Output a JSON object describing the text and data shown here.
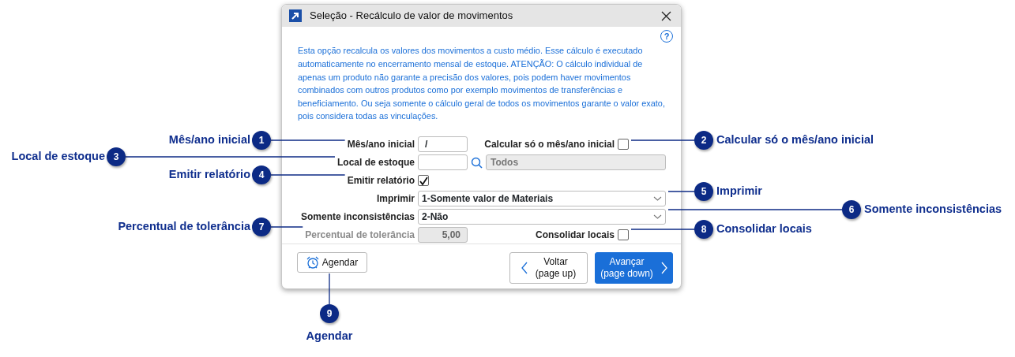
{
  "window": {
    "title": "Seleção - Recálculo de valor de movimentos"
  },
  "help": "?",
  "description": "Esta opção recalcula os valores dos movimentos a custo médio. Esse cálculo é executado automaticamente no encerramento mensal de estoque. ATENÇÃO: O cálculo individual de apenas um produto não garante a precisão dos valores, pois podem haver movimentos combinados com outros produtos como por exemplo movimentos de transferências e beneficiamento. Ou seja somente o cálculo geral de todos os movimentos garante o valor exato, pois considera todas as vinculações.",
  "fields": [
    {
      "kind": "text",
      "label": "Mês/ano inicial",
      "value": "/",
      "disabled": false,
      "side": {
        "label": "Calcular só o mês/ano inicial",
        "checked": false
      }
    },
    {
      "kind": "lookup",
      "label": "Local de estoque",
      "lookup_value": "Todos",
      "disabled": false
    },
    {
      "kind": "checkbox",
      "label": "Emitir relatório",
      "checked": true,
      "disabled": false
    },
    {
      "kind": "select",
      "label": "Imprimir",
      "value": "1-Somente valor de Materiais",
      "disabled": false
    },
    {
      "kind": "select",
      "label": "Somente inconsistências",
      "value": "2-Não",
      "disabled": false
    },
    {
      "kind": "text",
      "label": "Percentual de tolerância",
      "value": "5,00",
      "disabled": true,
      "side": {
        "label": "Consolidar locais",
        "checked": false
      }
    }
  ],
  "buttons": [
    {
      "kind": "schedule",
      "label": "Agendar"
    },
    {
      "kind": "back",
      "label": "Voltar",
      "hint": "(page up)",
      "primary": false
    },
    {
      "kind": "next",
      "label": "Avançar",
      "hint": "(page down)",
      "primary": true
    }
  ],
  "callouts": [
    {
      "number": "1",
      "label": "Mês/ano inicial"
    },
    {
      "number": "2",
      "label": "Calcular só o mês/ano inicial"
    },
    {
      "number": "3",
      "label": "Local de estoque"
    },
    {
      "number": "4",
      "label": "Emitir relatório"
    },
    {
      "number": "5",
      "label": "Imprimir"
    },
    {
      "number": "6",
      "label": "Somente inconsistências"
    },
    {
      "number": "7",
      "label": "Percentual de tolerância"
    },
    {
      "number": "8",
      "label": "Consolidar locais"
    },
    {
      "number": "9",
      "label": "Agendar"
    }
  ]
}
